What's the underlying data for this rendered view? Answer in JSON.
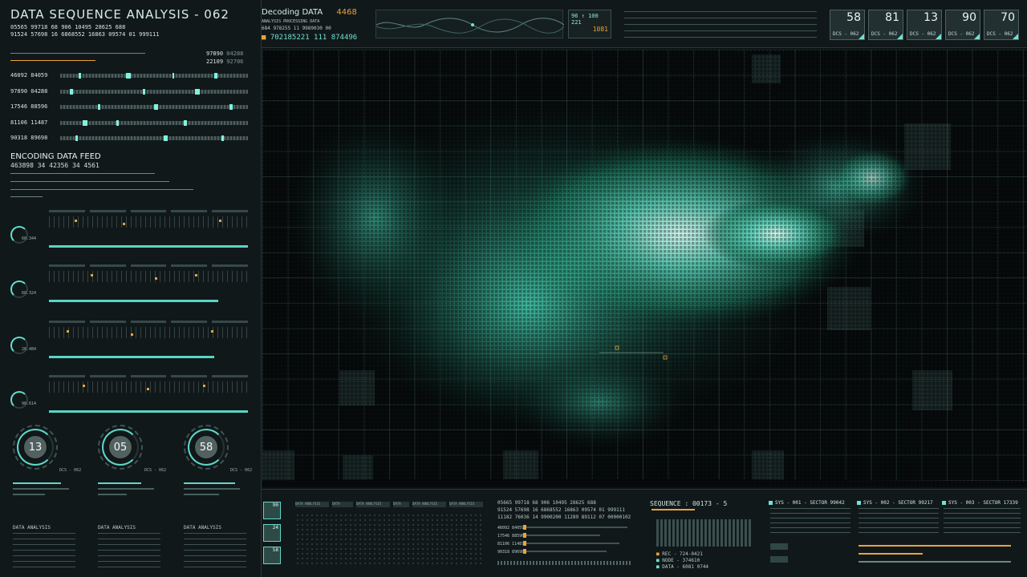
{
  "header": {
    "title": "DATA SEQUENCE ANALYSIS - 062",
    "stats_row1": "05565 99718  68  906  10495  28625  688",
    "stats_row2": "91524 57698  16  6868552  16863  09574  01  999111",
    "right_a": "97890",
    "right_a2": "04288",
    "right_b": "22109",
    "right_b2": "92706"
  },
  "left_bars": [
    {
      "label": "46092  84059"
    },
    {
      "label": "97890  04288"
    },
    {
      "label": "17546  88596"
    },
    {
      "label": "81106  11487"
    },
    {
      "label": "90318  89698"
    }
  ],
  "feed": {
    "title": "ENCODING DATA FEED",
    "row": "463898   34  42356   34   4561"
  },
  "modules": [
    {
      "value": "60.344",
      "fill": 1.0
    },
    {
      "value": "60.324",
      "fill": 0.85
    },
    {
      "value": "26.484",
      "fill": 0.83
    },
    {
      "value": "90.614",
      "fill": 1.0
    }
  ],
  "dials": [
    {
      "value": "13",
      "sub": "DCS - 062"
    },
    {
      "value": "05",
      "sub": "DCS - 062"
    },
    {
      "value": "58",
      "sub": "DCS - 062"
    }
  ],
  "left_bottom_labels": [
    "DATA ANALYSIS",
    "DATA ANALYSIS",
    "DATA ANALYSIS"
  ],
  "decoding": {
    "label": "Decoding DATA",
    "value": "4468",
    "sub": "ANALYSIS PROCESSING DATA",
    "code_row": "684  978255  11  9989030  00",
    "big_row": "702185221  111  874496"
  },
  "small_box": {
    "line1": "96 ↑ 100 221",
    "line2": "1081"
  },
  "top_cards": [
    {
      "value": "58",
      "label": "DCS - 062"
    },
    {
      "value": "81",
      "label": "DCS - 062"
    },
    {
      "value": "13",
      "label": "DCS - 062"
    },
    {
      "value": "90",
      "label": "DCS - 062"
    },
    {
      "value": "70",
      "label": "DCS - 062"
    }
  ],
  "bottom": {
    "thumbs": [
      "90",
      "24",
      "58"
    ],
    "tabs": [
      "DATA ANALYSIS",
      "DATA",
      "DATA ANALYSIS",
      "DATA",
      "DATA ANALYSIS",
      "DATA ANALYSIS"
    ],
    "code_row1": "05665  99718  68  906  10495  28625  688",
    "code_row2": "91524  57698  16  6868552  16863  09574  01  999111",
    "code_row3": "11182  76036  14  9900200  11289  89112  07  00000102",
    "slider_labels": [
      "46092 84059",
      "17546 88596",
      "81106 11487",
      "90318 89698"
    ],
    "sequence_label": "SEQUENCE",
    "sequence_value": "00173 - 5",
    "seq_items": [
      "REC - 724-0421",
      "NODE - 374610",
      "DATA - 6081 0744"
    ],
    "sys": [
      {
        "title": "SYS - 001 - SECTOR 99042"
      },
      {
        "title": "SYS - 002 - SECTOR 99217"
      },
      {
        "title": "SYS - 003 - SECTOR 17339"
      }
    ]
  },
  "colors": {
    "accent": "#6fe3d3",
    "warning": "#e8a43c",
    "bg": "#0d1214"
  }
}
